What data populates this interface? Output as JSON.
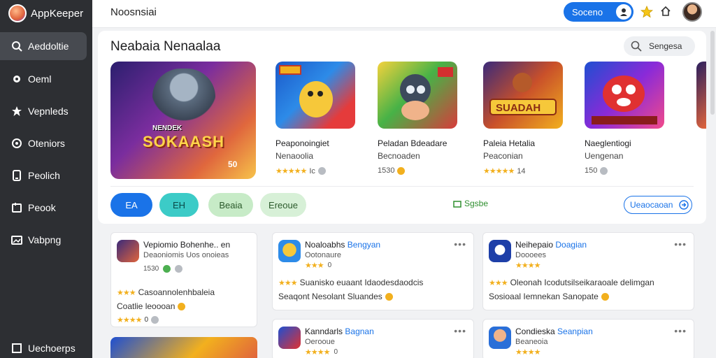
{
  "sidebar": {
    "brand": "AppKeeper",
    "items": [
      {
        "label": "Aeddoltie",
        "icon": "search-icon"
      },
      {
        "label": "Oeml",
        "icon": "gear-icon"
      },
      {
        "label": "Vepnleds",
        "icon": "star-icon"
      },
      {
        "label": "Oteniors",
        "icon": "circle-icon"
      },
      {
        "label": "Peolich",
        "icon": "device-icon"
      },
      {
        "label": "Peook",
        "icon": "book-icon"
      },
      {
        "label": "Vabpng",
        "icon": "image-icon"
      }
    ],
    "footer": "Uechoerps"
  },
  "header": {
    "title": "Noosnsiai",
    "button_label": "Soceno",
    "avatar_icon": "avatar-icon"
  },
  "featured": {
    "title": "Neabaia Nenaalaa",
    "search_label": "Sengesa",
    "hero": {
      "sub": "NENDEK",
      "title": "SOKAASH",
      "badge": "50"
    },
    "apps": [
      {
        "name": "Peaponoingiet",
        "sub": "Nenaoolia",
        "meta": "Ic"
      },
      {
        "name": "Peladan Bdeadare",
        "sub": "Becnoaden",
        "meta": "1530"
      },
      {
        "name": "Paleia Hetalia",
        "sub": "Peaconian",
        "meta": "14"
      },
      {
        "name": "Naeglentiogi",
        "sub": "Uengenan",
        "meta": "150"
      }
    ],
    "chips": [
      {
        "label": "EA"
      },
      {
        "label": "EH"
      },
      {
        "label": "Beaia"
      },
      {
        "label": "Ereoue"
      }
    ],
    "promo": "Sgsbe",
    "see_all": "Ueaocaoan"
  },
  "lists": {
    "left": {
      "title": "Vepiomio Bohenhe..",
      "title_extra": "en",
      "sub": "Deaoniomis Uos onoieas",
      "meta": "1530",
      "line1": "Casoannolenhbaleia",
      "line2": "Coatlie leoooan",
      "meta2": "0"
    },
    "middle": [
      {
        "title": "Noaloabhs",
        "title_blue": "Bengyan",
        "sub": "Ootonaure",
        "meta": "0",
        "line1": "Suanisko euaant Idaodesdaodcis",
        "line2": "Seaqont Nesolant Sluandes"
      },
      {
        "title": "Kanndarls",
        "title_blue": "Bagnan",
        "sub": "Oerooue",
        "meta": "0"
      }
    ],
    "right": [
      {
        "title": "Neihepaio",
        "title_blue": "Doagian",
        "sub": "Doooees",
        "line1": "Oleonah Icodutsilseikaraoale delimgan",
        "line2": "Sosioaal Iemnekan Sanopate"
      },
      {
        "title": "Condieska",
        "title_blue": "Seanpian",
        "sub": "Beaneoia"
      }
    ]
  },
  "colors": {
    "accent": "#1a73e8",
    "sidebar": "#2d2f33",
    "star": "#f2b01e"
  }
}
